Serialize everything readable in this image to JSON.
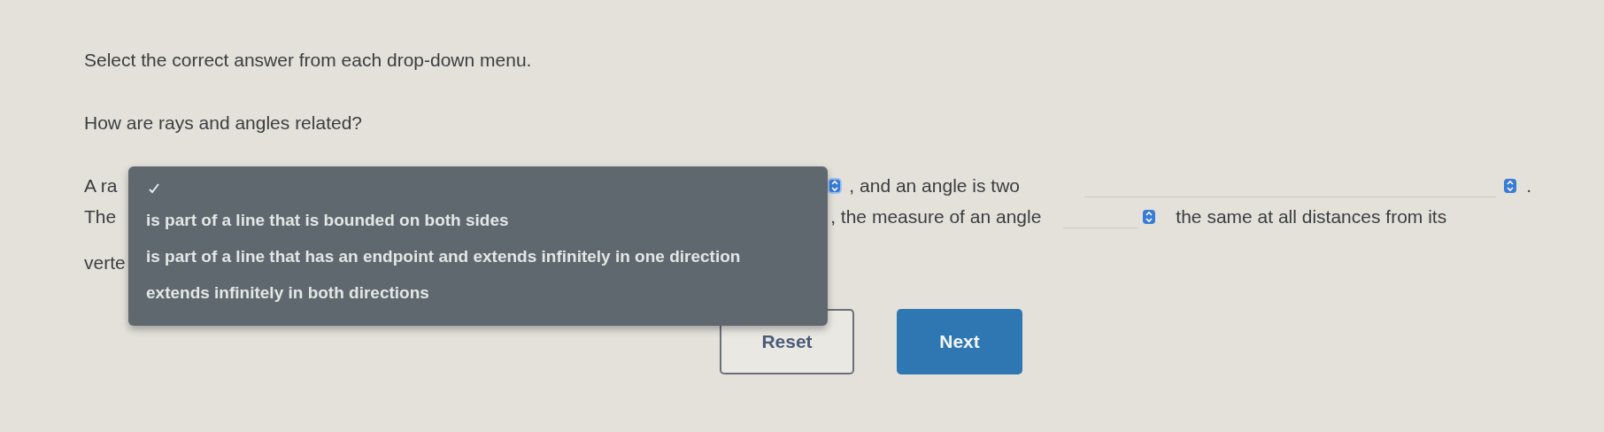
{
  "instruction": "Select the correct answer from each drop-down menu.",
  "question": "How are rays and angles related?",
  "line_1": {
    "start": "A ra",
    "middle": ", and an angle is two",
    "end": "."
  },
  "line_2": {
    "start": "The",
    "middle": ", the measure of an angle",
    "end": "the same at all distances from its"
  },
  "line_3": {
    "start": "verte"
  },
  "menu": {
    "expanded": true,
    "blank_option_selected": true,
    "options": [
      {
        "label": "is part of a line that is bounded on both sides",
        "selected": false
      },
      {
        "label": "is part of a line that has an endpoint and extends infinitely in one direction",
        "selected": false
      },
      {
        "label": "extends infinitely in both directions",
        "selected": false
      }
    ]
  },
  "buttons": [
    {
      "label": "Reset",
      "kind": "secondary"
    },
    {
      "label": "Next",
      "kind": "primary"
    }
  ]
}
